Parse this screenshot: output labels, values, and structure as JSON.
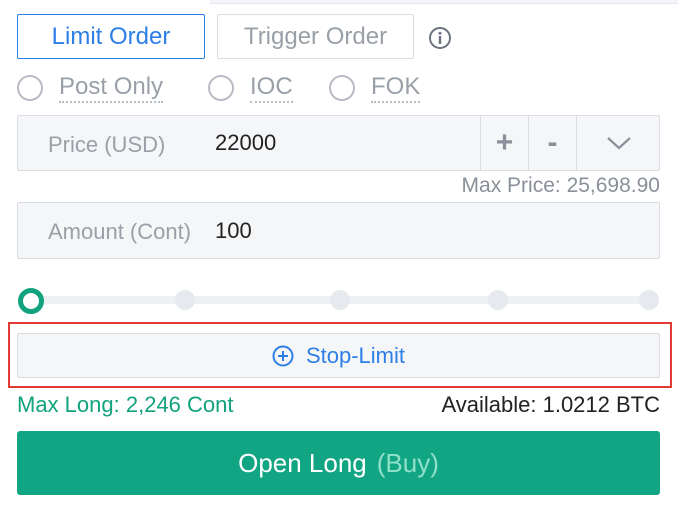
{
  "order_tabs": {
    "limit_label": "Limit Order",
    "trigger_label": "Trigger Order"
  },
  "options": [
    {
      "label": "Post Only"
    },
    {
      "label": "IOC"
    },
    {
      "label": "FOK"
    }
  ],
  "price": {
    "label": "Price (USD)",
    "value": "22000",
    "plus_label": "+",
    "minus_label": "-"
  },
  "max_price": {
    "label": "Max Price:",
    "value": "25,698.90"
  },
  "amount": {
    "label": "Amount (Cont)",
    "value": "100"
  },
  "slider": {
    "value_percent": 0,
    "stops": 5
  },
  "stop_limit": {
    "label": "Stop-Limit"
  },
  "max_long": {
    "label": "Max Long:",
    "value": "2,246 Cont"
  },
  "available": {
    "label": "Available:",
    "value": "1.0212 BTC"
  },
  "submit": {
    "label": "Open Long",
    "sub_label": "(Buy)"
  },
  "colors": {
    "accent_blue": "#2d7ee6",
    "buy_green": "#11a584",
    "highlight_red": "#e23b36"
  },
  "icons": [
    "info-icon",
    "chevron-down-icon",
    "plus-circle-icon"
  ]
}
